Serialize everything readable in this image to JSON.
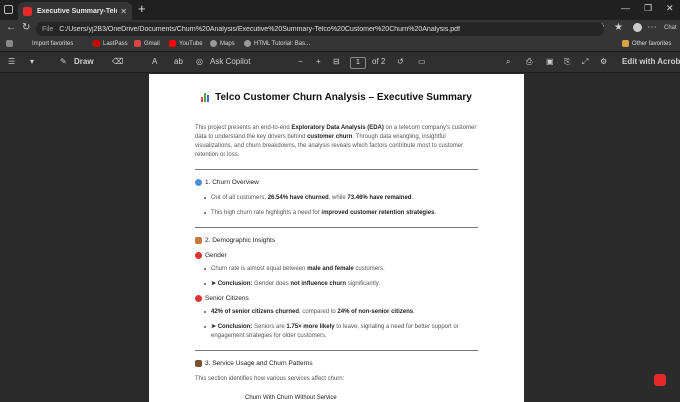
{
  "browser": {
    "tab_title": "Executive Summary-Telco Custom",
    "url_prefix": "File",
    "url": "C:/Users/yj2B3/OneDrive/Documents/Churn%20Analysis/Executive%20Summary-Telco%20Customer%20Churn%20Analysis.pdf",
    "chat_label": "Chat",
    "bookmarks": [
      "Import favorites",
      "LastPass",
      "Gmail",
      "YouTube",
      "Maps",
      "HTML Tutorial: Bas...",
      "Other favorites"
    ]
  },
  "toolbar": {
    "draw": "Draw",
    "ask_copilot": "Ask Copilot",
    "page_current": "1",
    "page_of": "of 2",
    "edit_acrobat": "Edit with Acrobat"
  },
  "doc": {
    "title": "Telco Customer Churn Analysis – Executive Summary",
    "intro_a": "This project presents an end-to-end ",
    "intro_b": "Exploratory Data Analysis (EDA)",
    "intro_c": " on a telecom company's customer data to understand the key drivers behind ",
    "intro_d": "customer churn",
    "intro_e": ". Through data wrangling, insightful visualizations, and churn breakdowns, the analysis reveals which factors contribute most to customer retention or loss.",
    "s1_title": "1. Churn Overview",
    "s1_b1_a": "Out of all customers, ",
    "s1_b1_b": "26.54% have churned",
    "s1_b1_c": ", while ",
    "s1_b1_d": "73.46% have remained",
    "s1_b1_e": ".",
    "s1_b2_a": "This high churn rate highlights a need for ",
    "s1_b2_b": "improved customer retention strategies",
    "s1_b2_c": ".",
    "s2_title": "2. Demographic Insights",
    "gender_title": "Gender",
    "g_b1_a": "Churn rate is almost equal between ",
    "g_b1_b": "male and female",
    "g_b1_c": " customers.",
    "g_b2_a": "➤ Conclusion:",
    "g_b2_b": " Gender does ",
    "g_b2_c": "not influence churn",
    "g_b2_d": " significantly.",
    "senior_title": "Senior Citizens",
    "sc_b1_a": "42% of senior citizens churned",
    "sc_b1_b": ", compared to ",
    "sc_b1_c": "24% of non-senior citizens",
    "sc_b1_d": ".",
    "sc_b2_a": "➤ Conclusion:",
    "sc_b2_b": " Seniors are ",
    "sc_b2_c": "1.75× more likely",
    "sc_b2_d": " to leave, signaling a need for better support or engagement strategies for older customers.",
    "s3_title": "3. Service Usage and Churn Patterns",
    "s3_intro": "This section identifies how various services affect churn:",
    "s3_table_header": "Churn With          Churn Without Service"
  }
}
